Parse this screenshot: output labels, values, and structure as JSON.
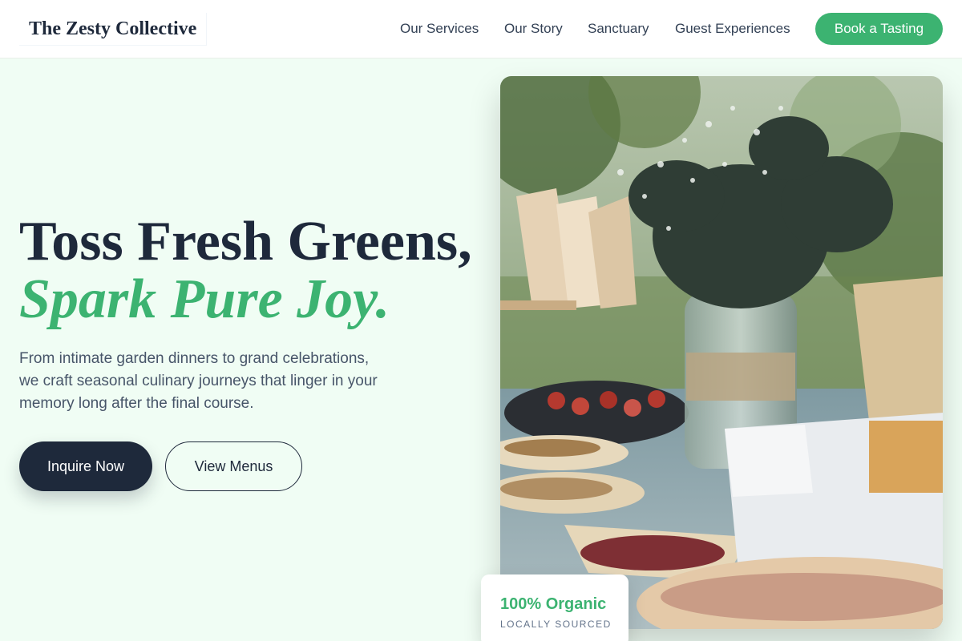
{
  "header": {
    "logo": "The Zesty Collective",
    "nav": [
      {
        "label": "Our Services"
      },
      {
        "label": "Our Story"
      },
      {
        "label": "Sanctuary"
      },
      {
        "label": "Guest Experiences"
      }
    ],
    "cta_label": "Book a Tasting"
  },
  "hero": {
    "title_line1": "Toss Fresh Greens,",
    "title_line2": "Spark Pure Joy.",
    "description": "From intimate garden dinners to grand celebrations, we craft seasonal culinary journeys that linger in your memory long after the final course.",
    "primary_button": "Inquire Now",
    "secondary_button": "View Menus"
  },
  "badge": {
    "title": "100% Organic",
    "subtitle": "LOCALLY SOURCED"
  },
  "colors": {
    "accent": "#3cb371",
    "dark": "#1e293b",
    "background": "#f0fdf4"
  }
}
